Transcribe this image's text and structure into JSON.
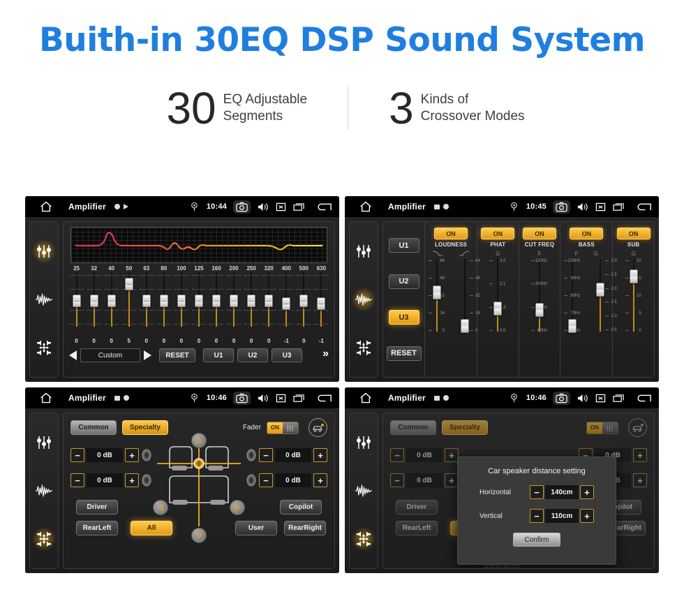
{
  "hero": {
    "title": "Buith-in 30EQ DSP Sound System",
    "stats": [
      {
        "number": "30",
        "line1": "EQ Adjustable",
        "line2": "Segments"
      },
      {
        "number": "3",
        "line1": "Kinds of",
        "line2": "Crossover Modes"
      }
    ]
  },
  "statusbar": {
    "title": "Amplifier",
    "times": {
      "eq": "10:44",
      "crossover": "10:45",
      "fader": "10:46",
      "dialog": "10:46"
    },
    "icons": [
      "home-icon",
      "location-pin-icon",
      "camera-icon",
      "volume-icon",
      "close-box-icon",
      "recent-apps-icon",
      "back-arrow-icon"
    ]
  },
  "sidebar": {
    "items": [
      {
        "name": "equalizer-icon",
        "label": "Equalizer"
      },
      {
        "name": "waveform-icon",
        "label": "Crossover"
      },
      {
        "name": "balance-icon",
        "label": "Fader"
      }
    ]
  },
  "eq_panel": {
    "frequencies": [
      "25",
      "32",
      "40",
      "50",
      "63",
      "80",
      "100",
      "125",
      "160",
      "200",
      "250",
      "320",
      "400",
      "500",
      "630"
    ],
    "values": [
      "0",
      "0",
      "0",
      "5",
      "0",
      "0",
      "0",
      "0",
      "0",
      "0",
      "0",
      "0",
      "-1",
      "0",
      "-1"
    ],
    "preset": "Custom",
    "reset_label": "RESET",
    "user_presets": [
      "U1",
      "U2",
      "U3"
    ],
    "more_label": "»",
    "prev_label": "◀",
    "next_label": "▶"
  },
  "crossover_panel": {
    "user_buttons": [
      {
        "label": "U1",
        "active": false
      },
      {
        "label": "U2",
        "active": false
      },
      {
        "label": "U3",
        "active": true
      }
    ],
    "reset_label": "RESET",
    "columns": [
      {
        "label": "LOUDNESS",
        "state": "ON",
        "sub": [
          "",
          ""
        ],
        "sliders": [
          {
            "scale_side": "left",
            "ticks": [
              "64",
              "48",
              "32",
              "16",
              "0"
            ],
            "pos": 46
          },
          {
            "scale_side": "right",
            "ticks": [
              "64",
              "48",
              "32",
              "16",
              "0"
            ],
            "pos": 92
          }
        ]
      },
      {
        "label": "PHAT",
        "state": "ON",
        "sub": [
          "G"
        ],
        "sliders": [
          {
            "scale_side": "left",
            "ticks": [
              "3.0",
              "2.1",
              "1.3",
              "0.5"
            ],
            "pos": 68
          }
        ]
      },
      {
        "label": "CUT FREQ",
        "state": "ON",
        "sub": [
          "F"
        ],
        "sliders": [
          {
            "scale_side": "left",
            "ticks": [
              "120Hz",
              "100Hz",
              "80Hz",
              "60Hz"
            ],
            "pos": 70
          }
        ]
      },
      {
        "label": "BASS",
        "state": "ON",
        "sub": [
          "F",
          "G"
        ],
        "sliders": [
          {
            "scale_side": "left",
            "ticks": [
              "100Hz",
              "90Hz",
              "80Hz",
              "70Hz",
              "60Hz"
            ],
            "pos": 92
          },
          {
            "scale_side": "right",
            "ticks": [
              "3.0",
              "2.5",
              "2.0",
              "1.5",
              "1.0",
              "0.5"
            ],
            "pos": 42
          }
        ]
      },
      {
        "label": "SUB",
        "state": "ON",
        "sub": [
          "G"
        ],
        "sliders": [
          {
            "scale_side": "left",
            "ticks": [
              "20",
              "15",
              "10",
              "5",
              "0"
            ],
            "pos": 24
          }
        ]
      }
    ]
  },
  "fader_panel": {
    "tabs": [
      {
        "label": "Common",
        "selected": false
      },
      {
        "label": "Specialty",
        "selected": true
      }
    ],
    "fader_label": "Fader",
    "fader_state": "ON",
    "car_setting_icon": "car-speaker-icon",
    "speaker_levels": [
      {
        "position": "front-left",
        "value": "0 dB"
      },
      {
        "position": "front-right",
        "value": "0 dB"
      },
      {
        "position": "rear-left",
        "value": "0 dB"
      },
      {
        "position": "rear-right",
        "value": "0 dB"
      }
    ],
    "minus_label": "−",
    "plus_label": "+",
    "buttons": [
      {
        "label": "Driver",
        "selected": false
      },
      {
        "label": "Copilot",
        "selected": false
      },
      {
        "label": "RearLeft",
        "selected": false
      },
      {
        "label": "All",
        "selected": true
      },
      {
        "label": "User",
        "selected": false
      },
      {
        "label": "RearRight",
        "selected": false
      }
    ]
  },
  "dialog": {
    "title": "Car speaker distance setting",
    "rows": [
      {
        "label": "Horizontal",
        "value": "140cm"
      },
      {
        "label": "Vertical",
        "value": "110cm"
      }
    ],
    "minus_label": "−",
    "plus_label": "+",
    "confirm_label": "Confirm"
  },
  "watermark": "Seicane",
  "colors": {
    "title_blue": "#1f7fe0",
    "accent_amber": "#e39a10",
    "panel_dark": "#1d1d1d"
  }
}
